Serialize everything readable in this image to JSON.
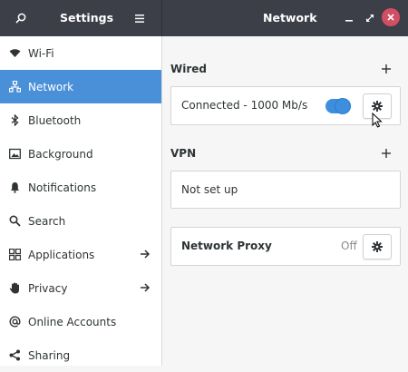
{
  "header": {
    "left_title": "Settings",
    "right_title": "Network",
    "icons": [
      "search-icon",
      "hamburger-menu-icon",
      "minimize-icon",
      "maximize-icon",
      "close-icon"
    ]
  },
  "sidebar": {
    "items": [
      {
        "label": "Wi-Fi",
        "icon": "wifi-icon"
      },
      {
        "label": "Network",
        "icon": "network-icon",
        "active": true
      },
      {
        "label": "Bluetooth",
        "icon": "bluetooth-icon"
      },
      {
        "label": "Background",
        "icon": "image-icon"
      },
      {
        "label": "Notifications",
        "icon": "bell-icon"
      },
      {
        "label": "Search",
        "icon": "search-icon"
      },
      {
        "label": "Applications",
        "icon": "apps-grid-icon",
        "has_arrow": true
      },
      {
        "label": "Privacy",
        "icon": "hand-icon",
        "has_arrow": true
      },
      {
        "label": "Online Accounts",
        "icon": "at-icon"
      },
      {
        "label": "Sharing",
        "icon": "share-icon"
      }
    ]
  },
  "main": {
    "wired": {
      "title": "Wired",
      "connection_label": "Connected - 1000 Mb/s",
      "toggle_on": true
    },
    "vpn": {
      "title": "VPN",
      "status": "Not set up"
    },
    "proxy": {
      "label": "Network Proxy",
      "status": "Off"
    }
  },
  "colors": {
    "header_bg": "#3c3f48",
    "accent": "#4a90d9",
    "toggle": "#3d8ede",
    "close_button": "#d24e64"
  }
}
